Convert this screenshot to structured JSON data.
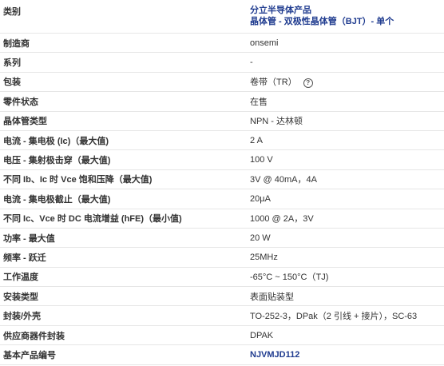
{
  "header": {
    "label": "类别",
    "category_link_1": "分立半导体产品",
    "category_link_2": "晶体管 - 双极性晶体管（BJT）- 单个"
  },
  "rows": [
    {
      "label": "制造商",
      "value": "onsemi"
    },
    {
      "label": "系列",
      "value": "-"
    },
    {
      "label": "包装",
      "value": "卷带（TR）"
    },
    {
      "label": "零件状态",
      "value": "在售"
    },
    {
      "label": "晶体管类型",
      "value": "NPN - 达林顿"
    },
    {
      "label": "电流 - 集电极 (Ic)（最大值)",
      "value": "2 A"
    },
    {
      "label": "电压 - 集射极击穿（最大值)",
      "value": "100 V"
    },
    {
      "label": "不同 Ib、Ic 时 Vce 饱和压降（最大值)",
      "value": "3V @ 40mA，4A"
    },
    {
      "label": "电流 - 集电极截止（最大值)",
      "value": "20µA"
    },
    {
      "label": "不同 Ic、Vce 时 DC 电流增益 (hFE)（最小值)",
      "value": "1000 @ 2A，3V"
    },
    {
      "label": "功率 - 最大值",
      "value": "20 W"
    },
    {
      "label": "频率 - 跃迁",
      "value": "25MHz"
    },
    {
      "label": "工作温度",
      "value": "-65°C ~ 150°C（TJ)"
    },
    {
      "label": "安装类型",
      "value": "表面贴装型"
    },
    {
      "label": "封装/外壳",
      "value": "TO-252-3，DPak（2 引线 + 接片），SC-63"
    },
    {
      "label": "供应商器件封装",
      "value": "DPAK"
    },
    {
      "label": "基本产品编号",
      "value": "NJVMJD112"
    }
  ],
  "icons": {
    "packaging_help": "question-circle-icon"
  },
  "colors": {
    "link": "#1f3b8f",
    "border": "#e6e6e6",
    "text": "#333333"
  }
}
